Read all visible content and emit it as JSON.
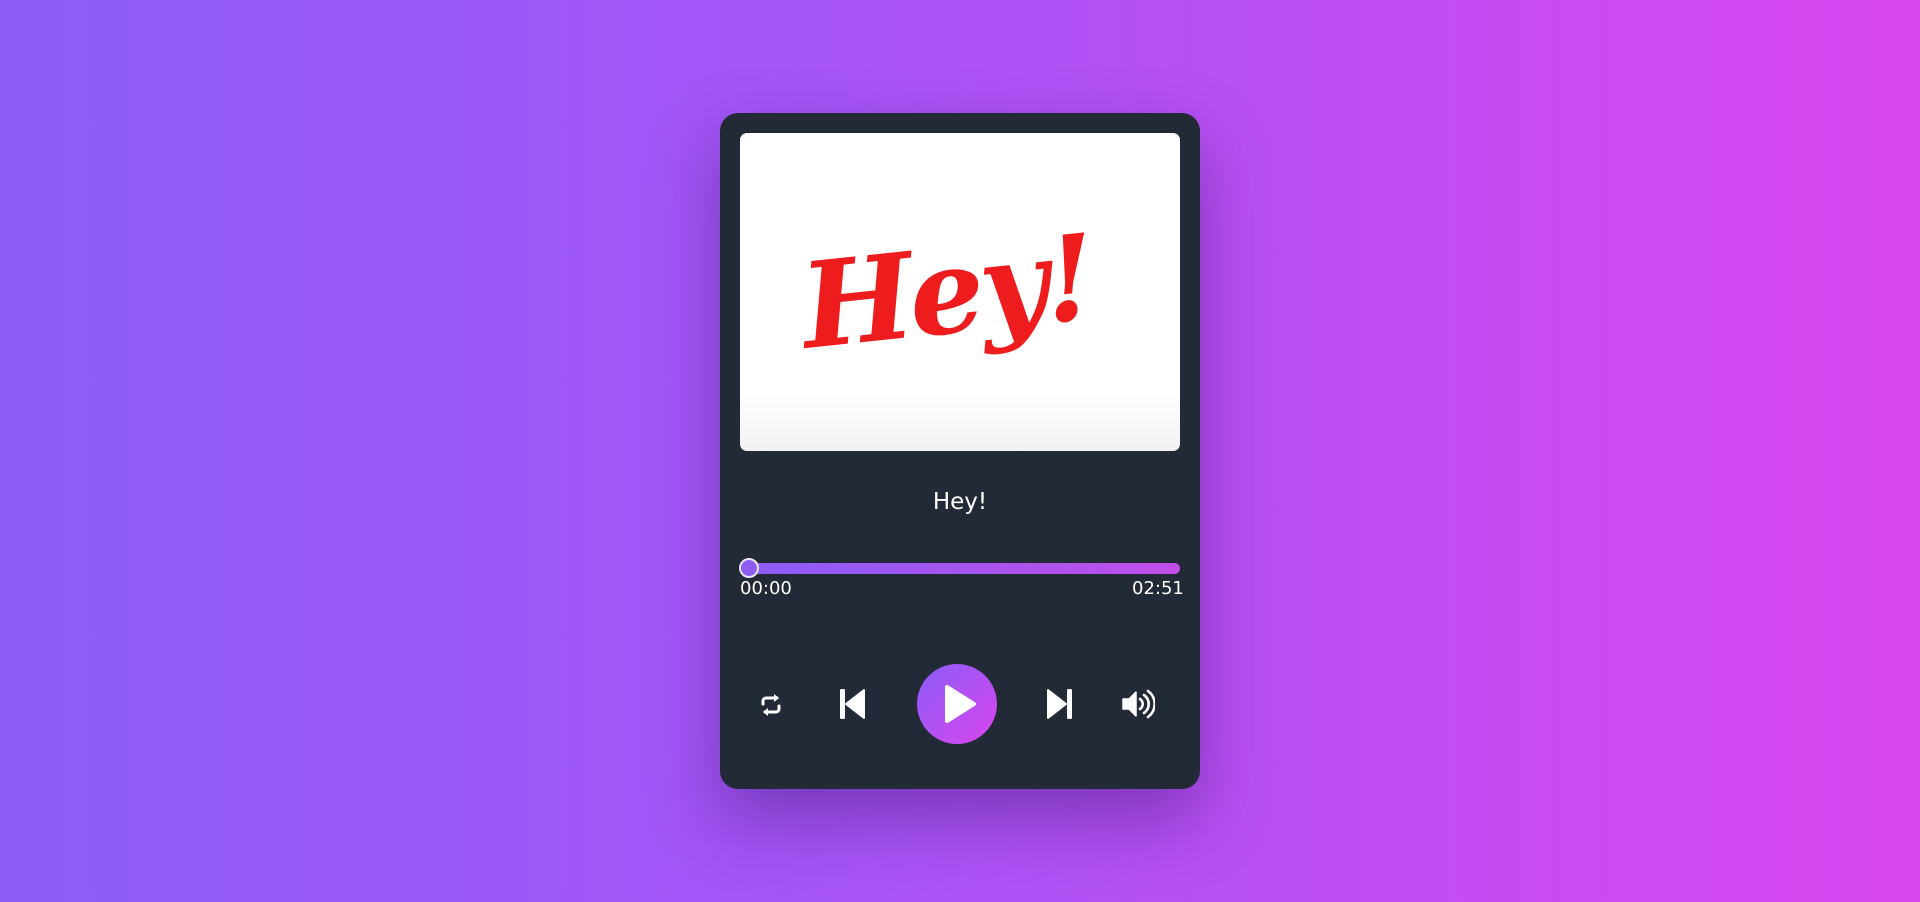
{
  "track": {
    "title": "Hey!",
    "cover_text": "Hey!",
    "current_time": "00:00",
    "duration": "02:51",
    "progress_fraction": 0
  },
  "controls": {
    "repeat_icon": "repeat-icon",
    "previous_icon": "skip-previous-icon",
    "play_icon": "play-icon",
    "next_icon": "skip-next-icon",
    "volume_icon": "volume-icon"
  },
  "colors": {
    "background_start": "#8b5cf6",
    "background_end": "#d946ef",
    "card": "#222a37",
    "cover_text": "#ee1c1c",
    "accent": "#a855f7"
  }
}
